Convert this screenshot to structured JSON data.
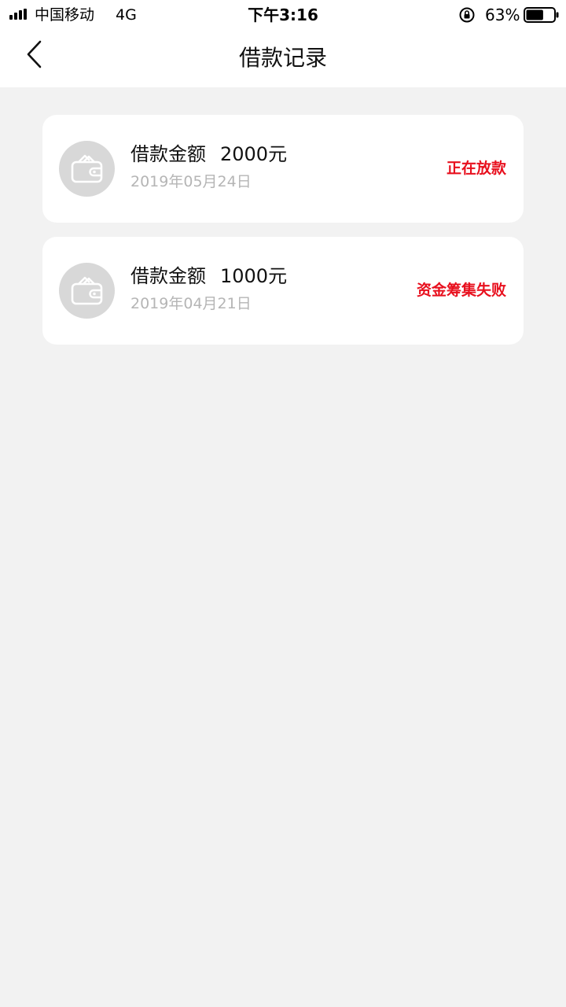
{
  "status_bar": {
    "carrier": "中国移动",
    "network": "4G",
    "time": "下午3:16",
    "battery_percent": "63%",
    "battery_level": 0.63,
    "icons": [
      "signal-icon",
      "rotation-lock-icon",
      "battery-icon"
    ]
  },
  "nav": {
    "title": "借款记录",
    "back_icon": "chevron-left-icon"
  },
  "records": [
    {
      "label": "借款金额",
      "amount": "2000元",
      "date": "2019年05月24日",
      "status": "正在放款",
      "icon": "wallet-icon"
    },
    {
      "label": "借款金额",
      "amount": "1000元",
      "date": "2019年04月21日",
      "status": "资金筹集失败",
      "icon": "wallet-icon"
    }
  ],
  "colors": {
    "background": "#f2f2f2",
    "card": "#ffffff",
    "status_red": "#e8101e",
    "date_gray": "#b5b5b5",
    "avatar_gray": "#d8d8d8"
  }
}
